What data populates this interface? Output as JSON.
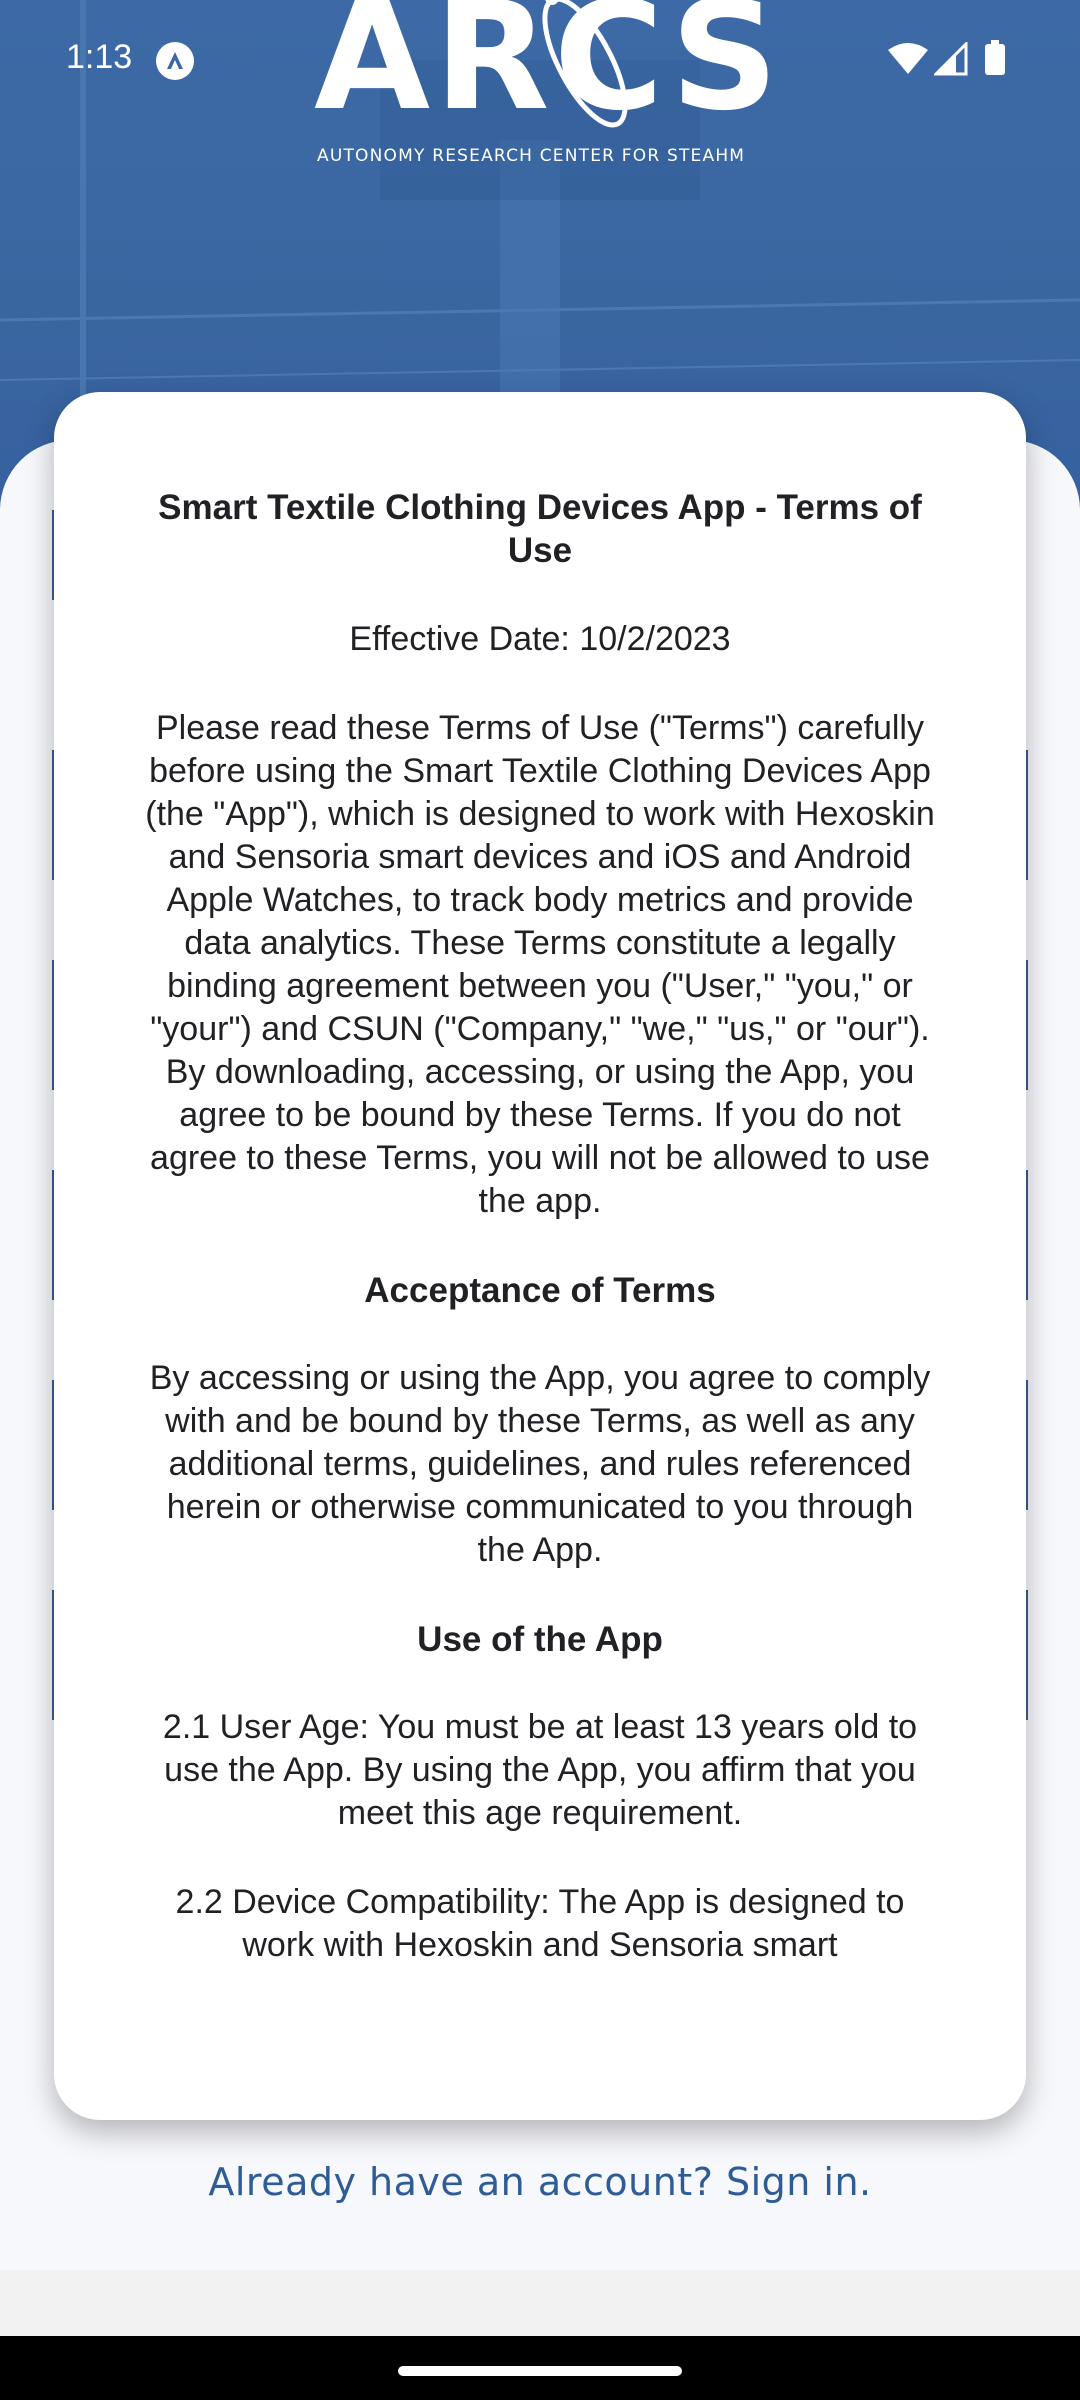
{
  "status_bar": {
    "time": "1:13"
  },
  "logo": {
    "wordmark": "ARCS",
    "subtitle": "AUTONOMY RESEARCH CENTER FOR STEAHM"
  },
  "terms": {
    "title": "Smart Textile Clothing Devices App - Terms of Use",
    "effective_date": "Effective Date: 10/2/2023",
    "intro": "Please read these Terms of Use (\"Terms\") carefully before using the Smart Textile Clothing Devices App (the \"App\"), which is designed to work with Hexoskin and Sensoria smart devices and iOS and Android Apple Watches, to track body metrics and provide data analytics. These Terms constitute a legally binding agreement between you (\"User,\" \"you,\" or \"your\") and CSUN (\"Company,\" \"we,\" \"us,\" or \"our\"). By downloading, accessing, or using the App, you agree to be bound by these Terms. If you do not agree to these Terms, you will not be allowed to use the app.",
    "section_acceptance_heading": "Acceptance of Terms",
    "section_acceptance_body": "By accessing or using the App, you agree to comply with and be bound by these Terms, as well as any additional terms, guidelines, and rules referenced herein or otherwise communicated to you through the App.",
    "section_use_heading": "Use of the App",
    "clause_2_1": "2.1 User Age: You must be at least 13 years old to use the App. By using the App, you affirm that you meet this age requirement.",
    "clause_2_2": "2.2 Device Compatibility: The App is designed to work with Hexoskin and Sensoria smart"
  },
  "footer": {
    "signin_link": "Already have an account? Sign in."
  },
  "colors": {
    "hero_blue": "#3d6aa6",
    "link_blue": "#2f5c97"
  }
}
